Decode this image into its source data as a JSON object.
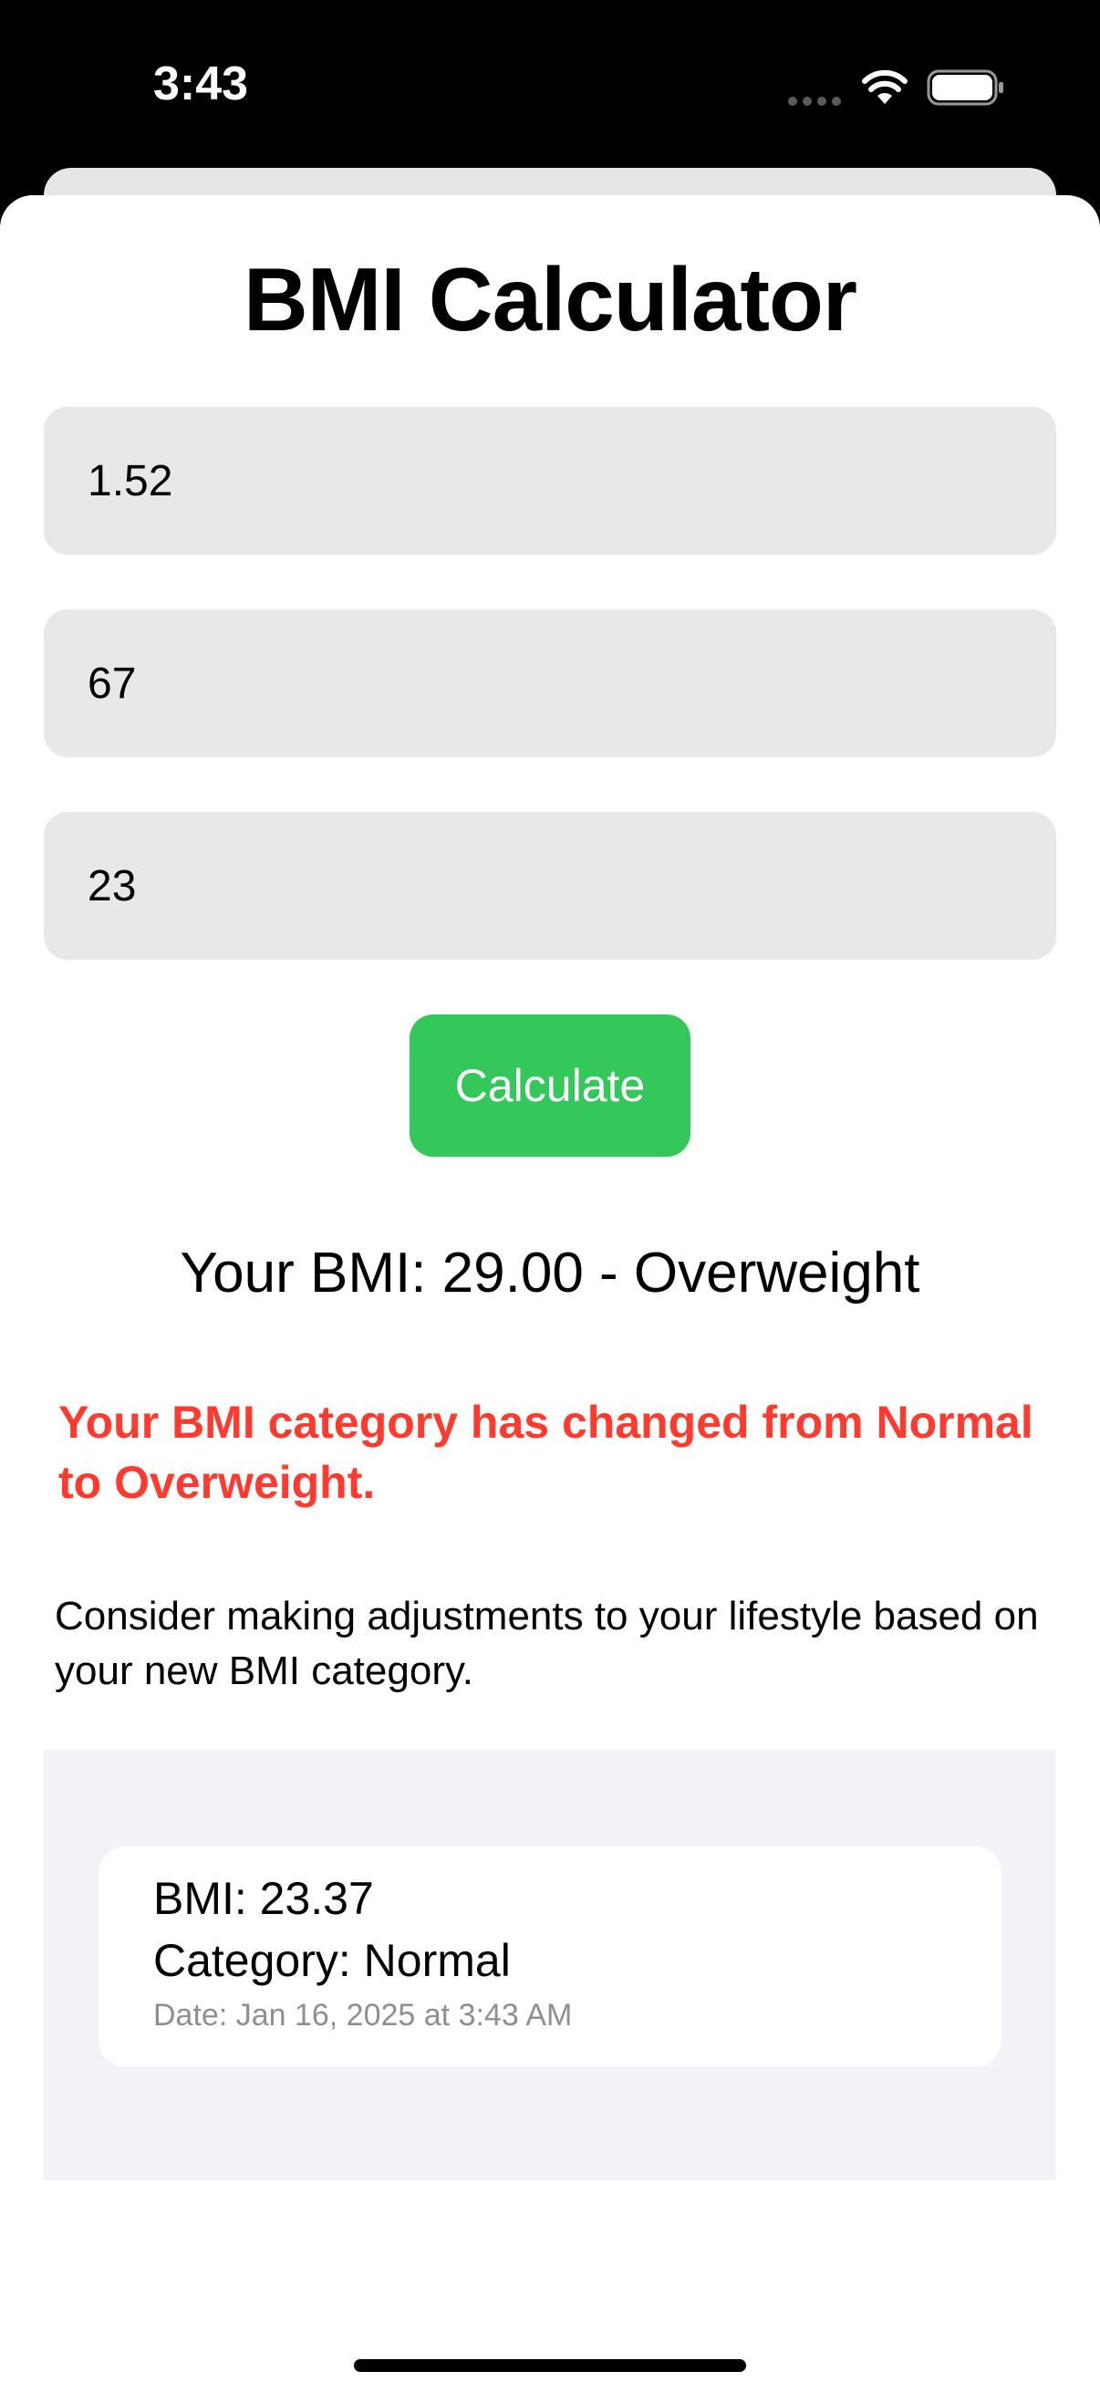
{
  "status_bar": {
    "time": "3:43",
    "icons": [
      "signal-dots-icon",
      "wifi-icon",
      "battery-icon"
    ]
  },
  "app": {
    "title": "BMI Calculator",
    "fields": {
      "height_value": "1.52",
      "weight_value": "67",
      "age_value": "23"
    },
    "calculate_label": "Calculate",
    "result_text": "Your BMI: 29.00 - Overweight",
    "change_alert": "Your BMI category has changed from Normal to Overweight.",
    "advice": "Consider making adjustments to your lifestyle based on your new BMI category.",
    "history": [
      {
        "bmi": "BMI: 23.37",
        "category": "Category: Normal",
        "date": "Date: Jan 16, 2025 at 3:43 AM"
      }
    ]
  },
  "colors": {
    "accent_green": "#34c759",
    "alert_red": "#ff3b30",
    "field_bg": "#e8e8e8",
    "panel_bg": "#f2f2f7",
    "secondary_text": "#8e8e93"
  }
}
